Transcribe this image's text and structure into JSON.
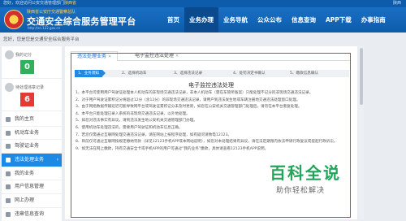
{
  "topbar": {
    "welcome_prefix": "您好，欢迎访问公安交通管理部门",
    "welcome_highlight": "陕西省",
    "right_text": "陕西"
  },
  "header": {
    "org": "陕西省公安厅交通警察总队",
    "title": "交通安全综合服务管理平台",
    "url": "http://sn.122.gov.cn",
    "nav": [
      "首页",
      "业务办理",
      "业务导航",
      "公众公布",
      "信息查询",
      "APP下载",
      "办事指南"
    ],
    "nav_current": "业务办理"
  },
  "breadcrumb": "您好，您是您是交通安全综合服务平台",
  "sidebar": {
    "stats": [
      {
        "label": "我的记分",
        "value": "0",
        "color": "#2fb05a"
      },
      {
        "label": "待处理违章记录",
        "value": "6",
        "color": "#e53935"
      }
    ],
    "items": [
      {
        "label": "我的主页",
        "active": false
      },
      {
        "label": "机动车业务",
        "active": false
      },
      {
        "label": "驾驶证业务",
        "active": false
      },
      {
        "label": "违法处理业务",
        "active": true
      },
      {
        "label": "我的业务",
        "active": false
      },
      {
        "label": "用户信息管理",
        "active": false
      },
      {
        "label": "网上办理",
        "active": false
      },
      {
        "label": "违章信息查询",
        "active": false
      }
    ]
  },
  "tabs": [
    {
      "label": "违法处理业务",
      "closable": true
    },
    {
      "label": "电子监控违法处理",
      "closable": true
    }
  ],
  "steps": [
    "1、业务须知",
    "2、选择机动车",
    "3、选择违法记录",
    "4、处罚决定书确认",
    "5、缴款信息确认"
  ],
  "panel_title": "电子监控违法处理",
  "rules": [
    "1、本平台可使用用户驾驶证处理本人机动车的非现场交通违法记录，非本人机动车（需在车管所备案）只能处理不记分的非现场交通违法记录。",
    "2、对于用户驾驶证累积记分将超过12分（含12分）的非现场交通违法记录，请用户到违法发生地或车辆注册地交通违法处理窗口处理。",
    "3、由于网络数据传输延迟可能导致网平台或驾驶证累积记分未及时更新，如您在公安机关交通管理部门处理后，请勿在本平台重复处理。",
    "4、本平台只能处理已录入系统的非现场交通违法记录，以外地处理。",
    "5、如您对违法事实有异议，请到违法发生地公安机关交通管理部门办理。",
    "6、使用机动车处理违法的，需要用户驾驶证和机动车信息正确。",
    "7、若您仅需通过互联网处理交通违法记录，请在网站上按程序处理，如有疑问请致电12123。",
    "8、目前仅可通过互联网按规定缴纳罚款（详见12123手机APP或本网站说明），如您对本处理结果有异议，请在法定期限内依法申请行政复议或提起行政诉讼。",
    "9、如无法在网上缴款，持有交通安全卡或手机APP的用户可通过“我的业务”缴款，具体请查看12123手机APP说明。"
  ],
  "watermark": {
    "brand": "百科全说",
    "slogan": "助你轻松解决"
  }
}
